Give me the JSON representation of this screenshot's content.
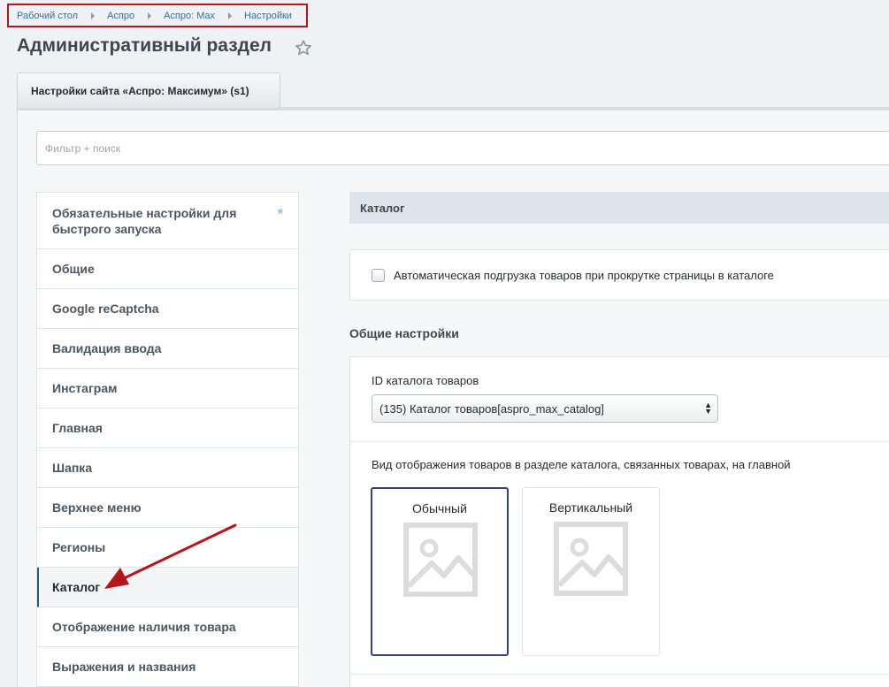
{
  "breadcrumb": [
    "Рабочий стол",
    "Аспро",
    "Аспро: Max",
    "Настройки"
  ],
  "page": {
    "title": "Административный раздел"
  },
  "tab": {
    "label": "Настройки сайта «Аспро: Максимум» (s1)"
  },
  "filter": {
    "placeholder": "Фильтр + поиск",
    "value": ""
  },
  "menu": {
    "items": [
      {
        "label": "Обязательные настройки для быстрого запуска",
        "required_mark": "*"
      },
      {
        "label": "Общие"
      },
      {
        "label": "Google reCaptcha"
      },
      {
        "label": "Валидация ввода"
      },
      {
        "label": "Инстаграм"
      },
      {
        "label": "Главная"
      },
      {
        "label": "Шапка"
      },
      {
        "label": "Верхнее меню"
      },
      {
        "label": "Регионы"
      },
      {
        "label": "Каталог",
        "active": true
      },
      {
        "label": "Отображение наличия товара"
      },
      {
        "label": "Выражения и названия"
      }
    ]
  },
  "section": {
    "title": "Каталог",
    "autoload": {
      "label": "Автоматическая подгрузка товаров при прокрутке страницы в каталоге",
      "checked": false
    },
    "general_title": "Общие настройки",
    "catalog_id": {
      "label": "ID каталога товаров",
      "value": "(135) Каталог товаров[aspro_max_catalog]"
    },
    "view_mode": {
      "label": "Вид отображения товаров в разделе каталога, связанных товарах, на главной",
      "options": [
        {
          "label": "Обычный",
          "selected": true
        },
        {
          "label": "Вертикальный",
          "selected": false
        }
      ]
    }
  },
  "colors": {
    "accent": "#1d5b8a",
    "annotation": "#b8141b",
    "selected_border": "#34427f"
  },
  "icons": {
    "favorite": "star-icon",
    "placeholder": "image-placeholder-icon"
  }
}
